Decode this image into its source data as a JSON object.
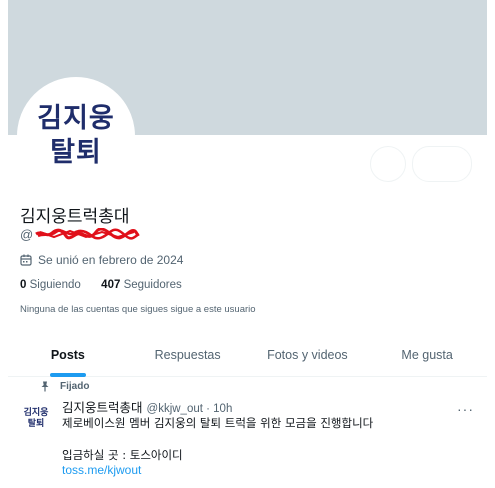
{
  "profile": {
    "avatar_line1": "김지웅",
    "avatar_line2": "탈퇴",
    "display_name": "김지웅트럭총대",
    "handle_prefix": "@",
    "joined": "Se unió en febrero de 2024",
    "following_count": "0",
    "following_label": "Siguiendo",
    "followers_count": "407",
    "followers_label": "Seguidores",
    "mutual_note": "Ninguna de las cuentas que sigues sigue a este usuario"
  },
  "tabs": [
    {
      "label": "Posts",
      "active": true
    },
    {
      "label": "Respuestas",
      "active": false
    },
    {
      "label": "Fotos y videos",
      "active": false
    },
    {
      "label": "Me gusta",
      "active": false
    }
  ],
  "post": {
    "pinned_label": "Fijado",
    "avatar_line1": "김지웅",
    "avatar_line2": "탈퇴",
    "author": "김지웅트럭총대",
    "meta": "@kkjw_out · 10h",
    "line1": "제로베이스원 멤버 김지웅의 탈퇴 트럭을 위한 모금을 진행합니다",
    "line2": "입금하실 곳 : 토스아이디",
    "link": "toss.me/kjwout",
    "more": "···"
  },
  "colors": {
    "banner": "#cfd9de",
    "accent": "#1d9bf0",
    "avatar_text": "#1f2d6b",
    "redaction": "#e0101a"
  }
}
